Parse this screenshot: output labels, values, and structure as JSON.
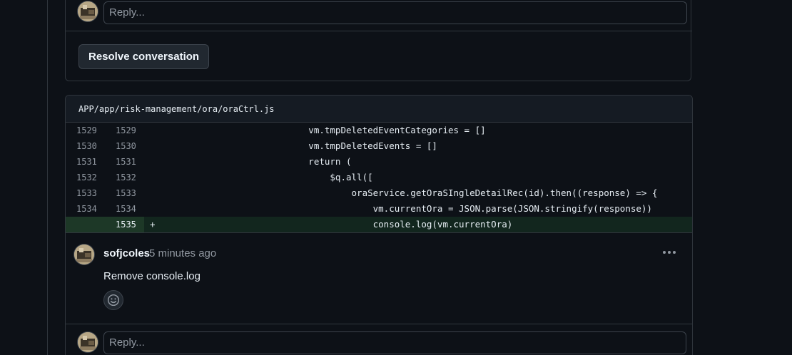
{
  "top_thread": {
    "reply_placeholder": "Reply...",
    "resolve_label": "Resolve conversation"
  },
  "file": {
    "path": "APP/app/risk-management/ora/oraCtrl.js",
    "lines": [
      {
        "old": "1529",
        "new": "1529",
        "marker": "",
        "code": "            vm.tmpDeletedEventCategories = []",
        "type": "context"
      },
      {
        "old": "1530",
        "new": "1530",
        "marker": "",
        "code": "            vm.tmpDeletedEvents = []",
        "type": "context"
      },
      {
        "old": "1531",
        "new": "1531",
        "marker": "",
        "code": "            return (",
        "type": "context"
      },
      {
        "old": "1532",
        "new": "1532",
        "marker": "",
        "code": "                $q.all([",
        "type": "context"
      },
      {
        "old": "1533",
        "new": "1533",
        "marker": "",
        "code": "                    oraService.getOraSIngleDetailRec(id).then((response) => {",
        "type": "context"
      },
      {
        "old": "1534",
        "new": "1534",
        "marker": "",
        "code": "                        vm.currentOra = JSON.parse(JSON.stringify(response))",
        "type": "context"
      },
      {
        "old": "",
        "new": "1535",
        "marker": "+",
        "code": "                        console.log(vm.currentOra)",
        "type": "added"
      }
    ]
  },
  "comment": {
    "author": "sofjcoles",
    "time": "5 minutes ago",
    "body": "Remove console.log",
    "menu_icon": "kebab-horizontal-icon",
    "reaction_icon": "smiley-icon"
  },
  "bottom_reply": {
    "placeholder": "Reply..."
  },
  "colors": {
    "background": "#0d1117",
    "border": "#30363d",
    "added_row": "#12261e",
    "added_gutter": "#1d3827"
  }
}
